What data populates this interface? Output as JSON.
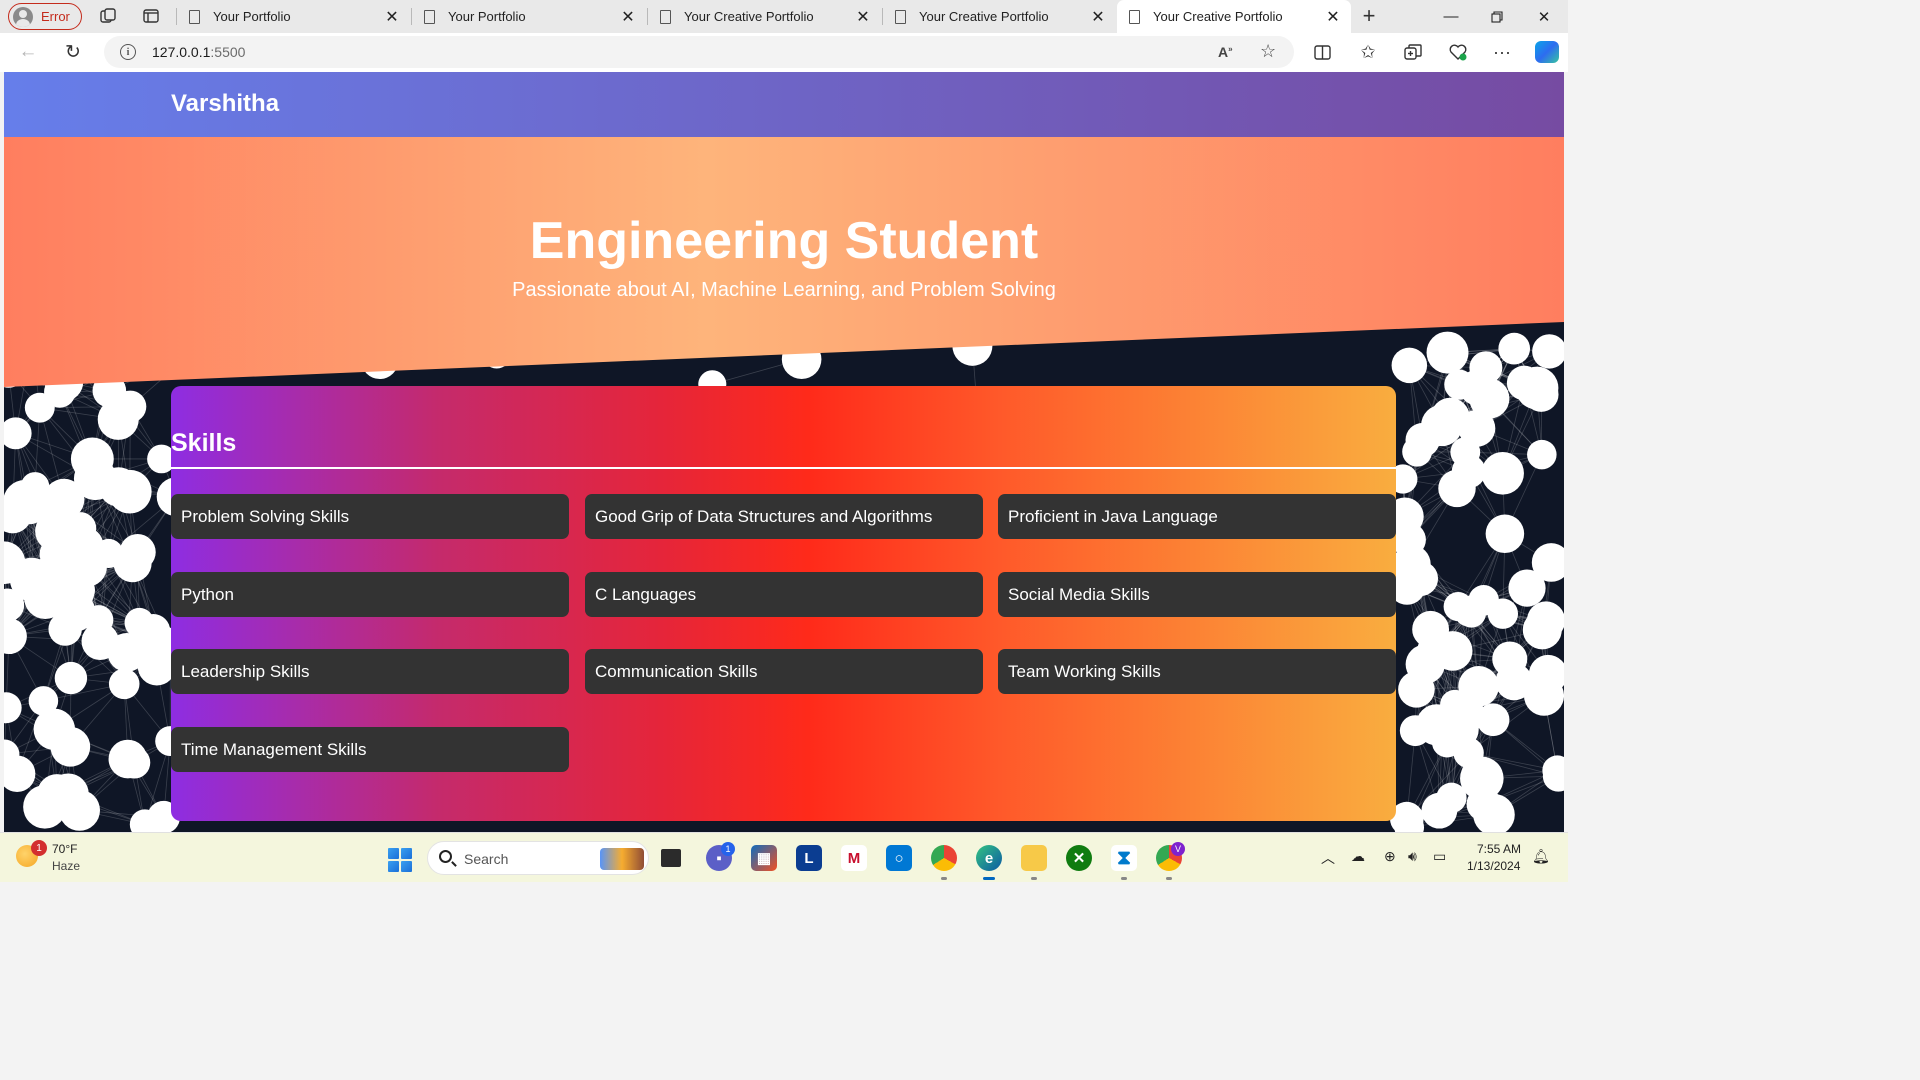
{
  "browser": {
    "profile_label": "Error",
    "tabs": [
      {
        "title": "Your Portfolio"
      },
      {
        "title": "Your Portfolio"
      },
      {
        "title": "Your Creative Portfolio"
      },
      {
        "title": "Your Creative Portfolio"
      },
      {
        "title": "Your Creative Portfolio"
      }
    ],
    "url_host": "127.0.0.1",
    "url_port": ":5500"
  },
  "page": {
    "brand": "Varshitha",
    "hero_title": "Engineering Student",
    "hero_subtitle": "Passionate about AI, Machine Learning, and Problem Solving",
    "skills_heading": "Skills",
    "skills": [
      "Problem Solving Skills",
      "Good Grip of Data Structures and Algorithms",
      "Proficient in Java Language",
      "Python",
      "C Languages",
      "Social Media Skills",
      "Leadership Skills",
      "Communication Skills",
      "Team Working Skills",
      "Time Management Skills"
    ]
  },
  "taskbar": {
    "weather_badge": "1",
    "weather_temp": "70°F",
    "weather_condition": "Haze",
    "search_placeholder": "Search",
    "teams_badge": "1",
    "chrome_badge": "V",
    "time": "7:55 AM",
    "date": "1/13/2024"
  },
  "colors": {
    "header_gradient": [
      "#667eea",
      "#764ba2"
    ],
    "hero_gradient": [
      "#ff7e5f",
      "#feb47b"
    ],
    "skills_gradient": [
      "#8e2de2",
      "#ff2a1a",
      "#f9ad3f"
    ],
    "skill_card": "#333333",
    "background": "#0f1626"
  }
}
